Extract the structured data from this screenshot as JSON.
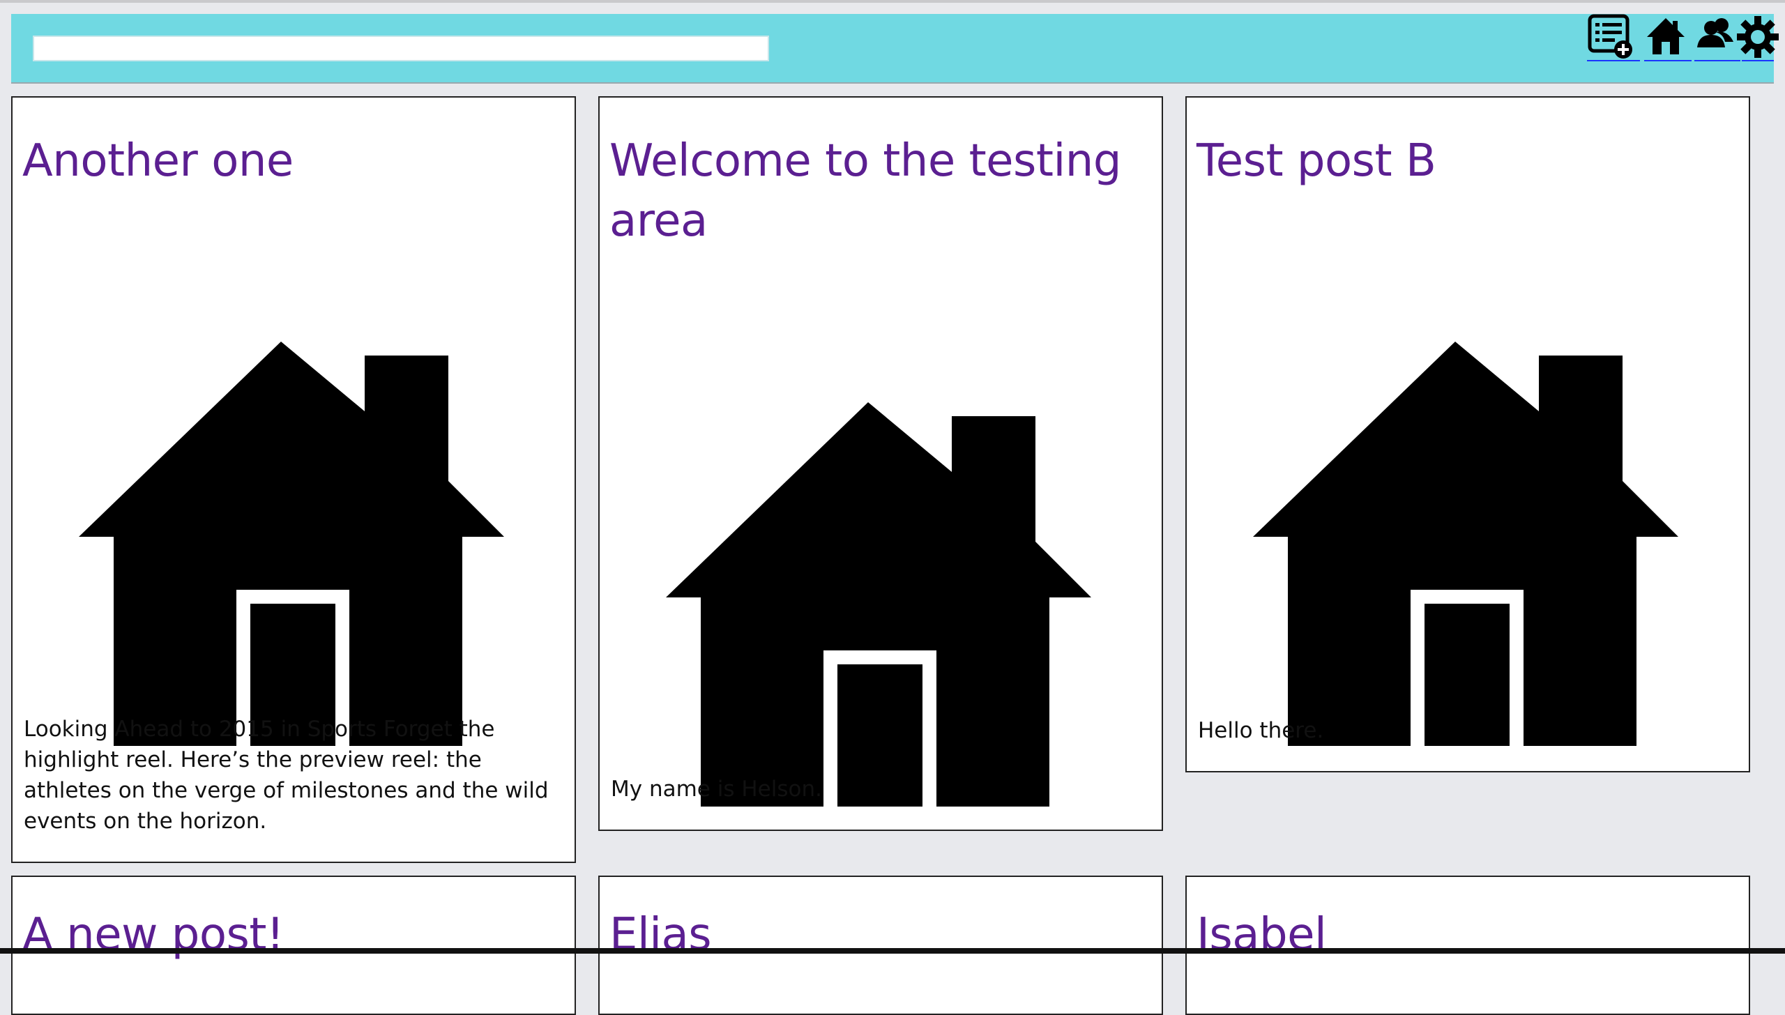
{
  "search": {
    "value": "",
    "placeholder": ""
  },
  "nav": [
    {
      "icon": "new-post-icon"
    },
    {
      "icon": "home-icon"
    },
    {
      "icon": "users-icon"
    },
    {
      "icon": "settings-icon"
    }
  ],
  "posts": [
    {
      "title": "Another one",
      "image": "house-icon",
      "body": "Looking Ahead to 2015 in Sports Forget the highlight reel. Here’s the preview reel: the athletes on the verge of milestones and the wild events on the horizon."
    },
    {
      "title": "Welcome to the testing area",
      "image": "house-icon",
      "body": "My name is Helson."
    },
    {
      "title": "Test post B",
      "image": "house-icon",
      "body": "Hello there."
    },
    {
      "title": "A new post!",
      "image": "",
      "body": ""
    },
    {
      "title": "Elias",
      "image": "",
      "body": ""
    },
    {
      "title": "Isabel",
      "image": "",
      "body": ""
    }
  ],
  "colors": {
    "header_bg": "#70d9e2",
    "page_bg": "#e8e9ed",
    "title": "#5b1f91",
    "link_underline": "#1a35ff"
  }
}
